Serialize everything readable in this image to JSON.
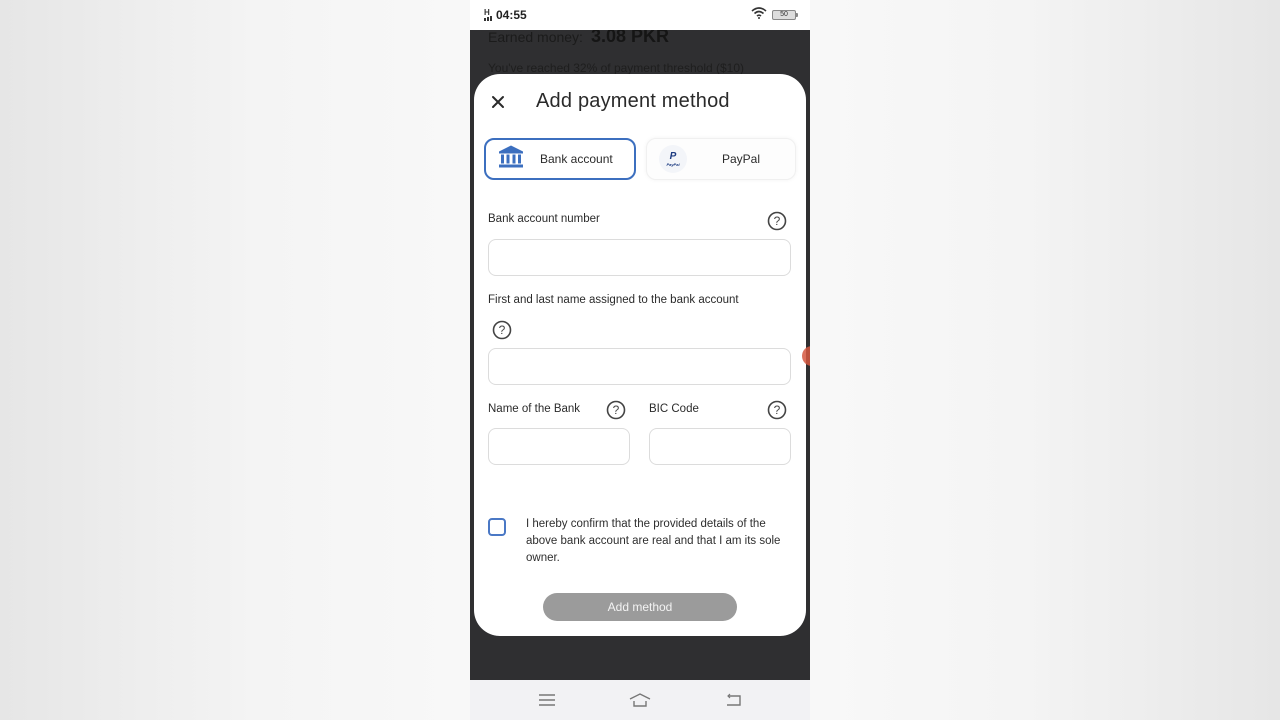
{
  "status_bar": {
    "network_label": "H",
    "time": "04:55",
    "battery_level": "50"
  },
  "background": {
    "earned_label": "Earned money:",
    "earned_value": "3.08 PKR",
    "threshold_text": "You've reached 32% of payment threshold ($10)"
  },
  "modal": {
    "title": "Add payment method",
    "close_icon": "close-icon",
    "tabs": [
      {
        "label": "Bank account",
        "icon": "bank-icon",
        "selected": true
      },
      {
        "label": "PayPal",
        "icon": "paypal-logo-icon",
        "selected": false
      }
    ],
    "paypal_icon_mark": "P",
    "paypal_icon_word": "PayPal",
    "fields": {
      "account_number": {
        "label": "Bank account number",
        "value": "",
        "placeholder": ""
      },
      "holder_name": {
        "label": "First and last name assigned to the bank account",
        "value": "",
        "placeholder": ""
      },
      "bank_name": {
        "label": "Name of the Bank",
        "value": "",
        "placeholder": ""
      },
      "bic_code": {
        "label": "BIC Code",
        "value": "",
        "placeholder": ""
      }
    },
    "confirm_checkbox": {
      "checked": false,
      "text": "I hereby confirm that the provided details of the above bank account are real and that I am its sole owner."
    },
    "submit_label": "Add method"
  },
  "colors": {
    "accent": "#3c6fbf",
    "button_disabled": "#9b9b9b",
    "overlay": "#2f2f31",
    "side_tab": "#d5573f"
  },
  "nav_bar": {
    "items": [
      "menu-icon",
      "home-icon",
      "back-icon"
    ]
  }
}
